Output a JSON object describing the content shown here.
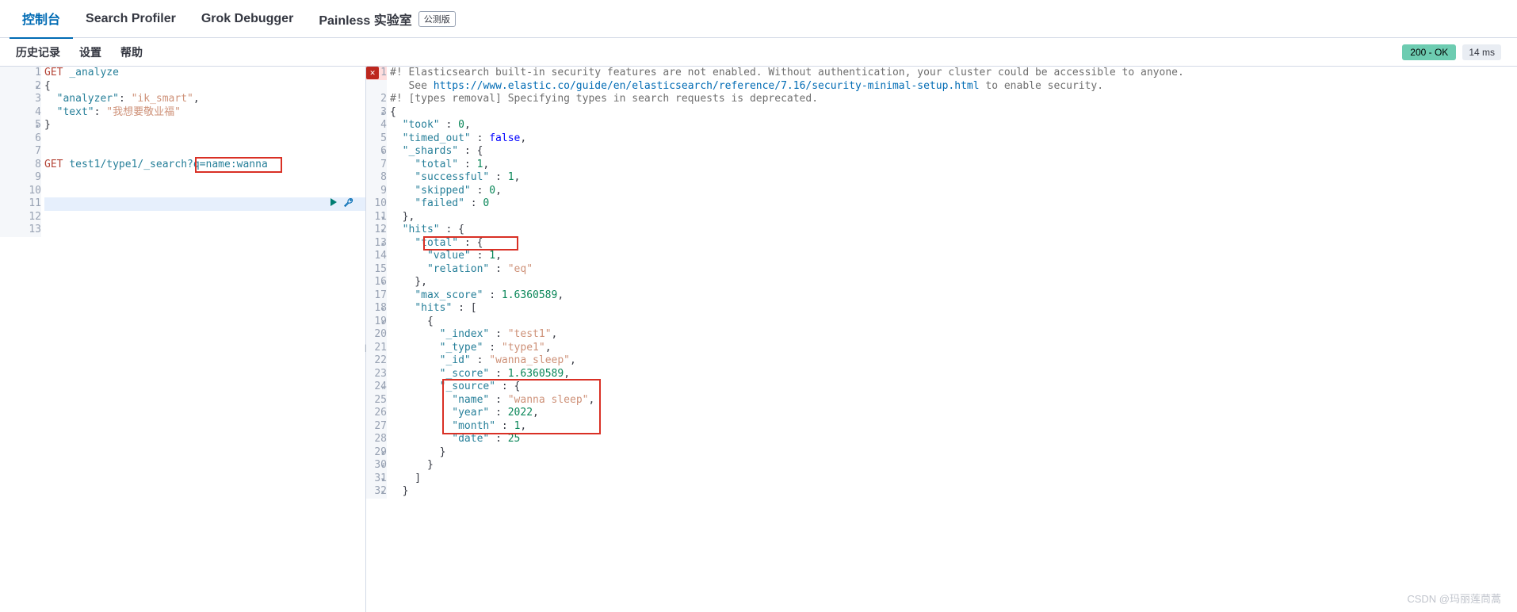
{
  "tabs": {
    "console": "控制台",
    "search_profiler": "Search Profiler",
    "grok_debugger": "Grok Debugger",
    "painless_lab": "Painless 实验室",
    "beta_badge": "公测版"
  },
  "subtabs": {
    "history": "历史记录",
    "settings": "设置",
    "help": "帮助"
  },
  "status": {
    "ok": "200 - OK",
    "time": "14 ms"
  },
  "request": {
    "lines": [
      {
        "num": "1",
        "tokens": [
          {
            "t": "GET",
            "c": "m"
          },
          {
            "t": " "
          },
          {
            "t": "_analyze",
            "c": "p"
          }
        ]
      },
      {
        "num": "2",
        "fold": "down",
        "tokens": [
          {
            "t": "{"
          }
        ]
      },
      {
        "num": "3",
        "tokens": [
          {
            "t": "  "
          },
          {
            "t": "\"analyzer\"",
            "c": "k"
          },
          {
            "t": ": "
          },
          {
            "t": "\"ik_smart\"",
            "c": "s"
          },
          {
            "t": ","
          }
        ]
      },
      {
        "num": "4",
        "tokens": [
          {
            "t": "  "
          },
          {
            "t": "\"text\"",
            "c": "k"
          },
          {
            "t": ": "
          },
          {
            "t": "\"我想要敬业福\"",
            "c": "s"
          }
        ]
      },
      {
        "num": "5",
        "fold": "down",
        "tokens": [
          {
            "t": "}"
          }
        ]
      },
      {
        "num": "6",
        "tokens": []
      },
      {
        "num": "7",
        "tokens": []
      },
      {
        "num": "8",
        "tokens": [
          {
            "t": "GET",
            "c": "m"
          },
          {
            "t": " "
          },
          {
            "t": "test1/type1/_search?",
            "c": "p"
          },
          {
            "t": "q=name:wanna",
            "c": "p"
          }
        ]
      },
      {
        "num": "9",
        "tokens": []
      },
      {
        "num": "10",
        "tokens": []
      },
      {
        "num": "11",
        "tokens": [],
        "cursor": true
      },
      {
        "num": "12",
        "tokens": []
      },
      {
        "num": "13",
        "tokens": []
      }
    ],
    "highlight": {
      "line": 8,
      "text": "q=name:wanna"
    }
  },
  "response": {
    "error_icon": "✕",
    "lines": [
      {
        "num": "1",
        "err": true,
        "tokens": [
          {
            "t": "#! Elasticsearch built-in security features are not enabled. Without authentication, your cluster could be accessible to anyone.",
            "c": "g"
          }
        ]
      },
      {
        "num": "",
        "tokens": [
          {
            "t": "   See ",
            "c": "g"
          },
          {
            "t": "https://www.elastic.co/guide/en/elasticsearch/reference/7.16/security-minimal-setup.html",
            "c": "u"
          },
          {
            "t": " to enable security.",
            "c": "g"
          }
        ]
      },
      {
        "num": "2",
        "tokens": [
          {
            "t": "#! [types removal] Specifying types in search requests is deprecated.",
            "c": "g"
          }
        ]
      },
      {
        "num": "3",
        "fold": "down",
        "tokens": [
          {
            "t": "{"
          }
        ]
      },
      {
        "num": "4",
        "tokens": [
          {
            "t": "  "
          },
          {
            "t": "\"took\"",
            "c": "k"
          },
          {
            "t": " : "
          },
          {
            "t": "0",
            "c": "n"
          },
          {
            "t": ","
          }
        ]
      },
      {
        "num": "5",
        "tokens": [
          {
            "t": "  "
          },
          {
            "t": "\"timed_out\"",
            "c": "k"
          },
          {
            "t": " : "
          },
          {
            "t": "false",
            "c": "b"
          },
          {
            "t": ","
          }
        ]
      },
      {
        "num": "6",
        "fold": "down",
        "tokens": [
          {
            "t": "  "
          },
          {
            "t": "\"_shards\"",
            "c": "k"
          },
          {
            "t": " : {"
          }
        ]
      },
      {
        "num": "7",
        "tokens": [
          {
            "t": "    "
          },
          {
            "t": "\"total\"",
            "c": "k"
          },
          {
            "t": " : "
          },
          {
            "t": "1",
            "c": "n"
          },
          {
            "t": ","
          }
        ]
      },
      {
        "num": "8",
        "tokens": [
          {
            "t": "    "
          },
          {
            "t": "\"successful\"",
            "c": "k"
          },
          {
            "t": " : "
          },
          {
            "t": "1",
            "c": "n"
          },
          {
            "t": ","
          }
        ]
      },
      {
        "num": "9",
        "tokens": [
          {
            "t": "    "
          },
          {
            "t": "\"skipped\"",
            "c": "k"
          },
          {
            "t": " : "
          },
          {
            "t": "0",
            "c": "n"
          },
          {
            "t": ","
          }
        ]
      },
      {
        "num": "10",
        "tokens": [
          {
            "t": "    "
          },
          {
            "t": "\"failed\"",
            "c": "k"
          },
          {
            "t": " : "
          },
          {
            "t": "0",
            "c": "n"
          }
        ]
      },
      {
        "num": "11",
        "fold": "down",
        "tokens": [
          {
            "t": "  },"
          }
        ]
      },
      {
        "num": "12",
        "fold": "down",
        "tokens": [
          {
            "t": "  "
          },
          {
            "t": "\"hits\"",
            "c": "k"
          },
          {
            "t": " : {"
          }
        ]
      },
      {
        "num": "13",
        "fold": "down",
        "tokens": [
          {
            "t": "    "
          },
          {
            "t": "\"total\"",
            "c": "k"
          },
          {
            "t": " : {"
          }
        ]
      },
      {
        "num": "14",
        "tokens": [
          {
            "t": "      "
          },
          {
            "t": "\"value\"",
            "c": "k"
          },
          {
            "t": " : "
          },
          {
            "t": "1",
            "c": "n"
          },
          {
            "t": ","
          }
        ]
      },
      {
        "num": "15",
        "tokens": [
          {
            "t": "      "
          },
          {
            "t": "\"relation\"",
            "c": "k"
          },
          {
            "t": " : "
          },
          {
            "t": "\"eq\"",
            "c": "s"
          }
        ]
      },
      {
        "num": "16",
        "fold": "down",
        "tokens": [
          {
            "t": "    },"
          }
        ]
      },
      {
        "num": "17",
        "tokens": [
          {
            "t": "    "
          },
          {
            "t": "\"max_score\"",
            "c": "k"
          },
          {
            "t": " : "
          },
          {
            "t": "1.6360589",
            "c": "n"
          },
          {
            "t": ","
          }
        ]
      },
      {
        "num": "18",
        "fold": "down",
        "tokens": [
          {
            "t": "    "
          },
          {
            "t": "\"hits\"",
            "c": "k"
          },
          {
            "t": " : ["
          }
        ]
      },
      {
        "num": "19",
        "fold": "down",
        "tokens": [
          {
            "t": "      {"
          }
        ]
      },
      {
        "num": "20",
        "tokens": [
          {
            "t": "        "
          },
          {
            "t": "\"_index\"",
            "c": "k"
          },
          {
            "t": " : "
          },
          {
            "t": "\"test1\"",
            "c": "s"
          },
          {
            "t": ","
          }
        ]
      },
      {
        "num": "21",
        "tokens": [
          {
            "t": "        "
          },
          {
            "t": "\"_type\"",
            "c": "k"
          },
          {
            "t": " : "
          },
          {
            "t": "\"type1\"",
            "c": "s"
          },
          {
            "t": ","
          }
        ]
      },
      {
        "num": "22",
        "tokens": [
          {
            "t": "        "
          },
          {
            "t": "\"_id\"",
            "c": "k"
          },
          {
            "t": " : "
          },
          {
            "t": "\"wanna_sleep\"",
            "c": "s"
          },
          {
            "t": ","
          }
        ]
      },
      {
        "num": "23",
        "tokens": [
          {
            "t": "        "
          },
          {
            "t": "\"_score\"",
            "c": "k"
          },
          {
            "t": " : "
          },
          {
            "t": "1.6360589",
            "c": "n"
          },
          {
            "t": ","
          }
        ]
      },
      {
        "num": "24",
        "fold": "down",
        "tokens": [
          {
            "t": "        "
          },
          {
            "t": "\"_source\"",
            "c": "k"
          },
          {
            "t": " : {"
          }
        ]
      },
      {
        "num": "25",
        "tokens": [
          {
            "t": "          "
          },
          {
            "t": "\"name\"",
            "c": "k"
          },
          {
            "t": " : "
          },
          {
            "t": "\"wanna sleep\"",
            "c": "s"
          },
          {
            "t": ","
          }
        ]
      },
      {
        "num": "26",
        "tokens": [
          {
            "t": "          "
          },
          {
            "t": "\"year\"",
            "c": "k"
          },
          {
            "t": " : "
          },
          {
            "t": "2022",
            "c": "n"
          },
          {
            "t": ","
          }
        ]
      },
      {
        "num": "27",
        "tokens": [
          {
            "t": "          "
          },
          {
            "t": "\"month\"",
            "c": "k"
          },
          {
            "t": " : "
          },
          {
            "t": "1",
            "c": "n"
          },
          {
            "t": ","
          }
        ]
      },
      {
        "num": "28",
        "tokens": [
          {
            "t": "          "
          },
          {
            "t": "\"date\"",
            "c": "k"
          },
          {
            "t": " : "
          },
          {
            "t": "25",
            "c": "n"
          }
        ]
      },
      {
        "num": "29",
        "fold": "down",
        "tokens": [
          {
            "t": "        }"
          }
        ]
      },
      {
        "num": "30",
        "fold": "down",
        "tokens": [
          {
            "t": "      }"
          }
        ]
      },
      {
        "num": "31",
        "fold": "down",
        "tokens": [
          {
            "t": "    ]"
          }
        ]
      },
      {
        "num": "32",
        "fold": "down",
        "tokens": [
          {
            "t": "  }"
          }
        ]
      }
    ]
  },
  "watermark": "CSDN @玛丽莲茼蒿"
}
